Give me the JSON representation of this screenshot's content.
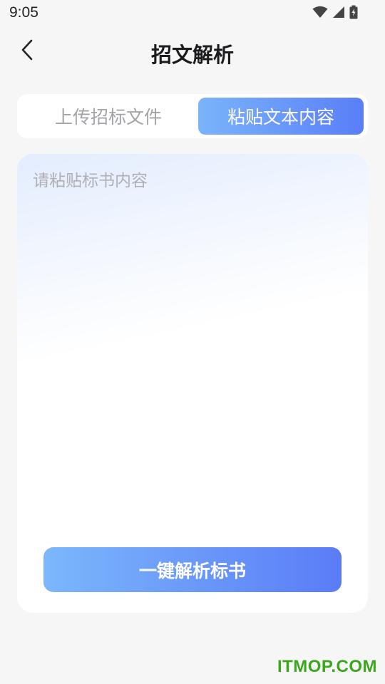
{
  "status_bar": {
    "time": "9:05",
    "icons": [
      "wifi-icon",
      "cell-signal-icon",
      "battery-charging-icon"
    ]
  },
  "header": {
    "back_icon": "chevron-left-icon",
    "title": "招文解析"
  },
  "tabs": [
    {
      "label": "上传招标文件",
      "active": false
    },
    {
      "label": "粘贴文本内容",
      "active": true
    }
  ],
  "editor": {
    "value": "",
    "placeholder": "请粘贴标书内容"
  },
  "actions": {
    "analyze_label": "一键解析标书"
  },
  "watermark": "ITMOP.COM",
  "colors": {
    "accent_start": "#7ab4fb",
    "accent_end": "#5a7ef8",
    "background": "#f6f6f7",
    "watermark": "#3aa71c"
  }
}
